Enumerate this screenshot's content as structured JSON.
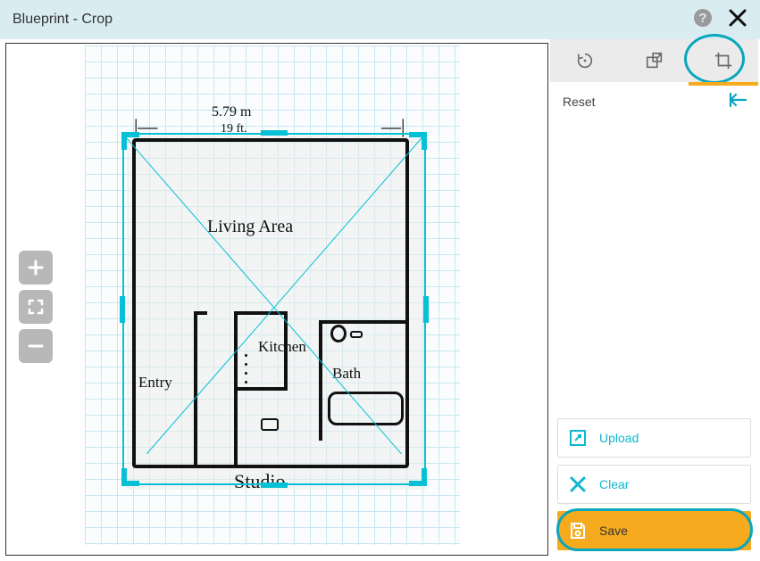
{
  "header": {
    "title": "Blueprint - Crop"
  },
  "drawing": {
    "dimension_m": "5.79 m",
    "dimension_ft": "19 ft.",
    "rooms": {
      "living": "Living Area",
      "kitchen": "Kitchen",
      "bath": "Bath",
      "entry": "Entry"
    },
    "caption": "Studio"
  },
  "sidebar": {
    "reset_label": "Reset",
    "actions": {
      "upload": "Upload",
      "clear": "Clear",
      "save": "Save"
    }
  },
  "tools": {
    "rotate": "rotate",
    "scale": "scale",
    "crop": "crop"
  },
  "colors": {
    "accent": "#06c1d6",
    "primary_action": "#f6ab1e"
  }
}
